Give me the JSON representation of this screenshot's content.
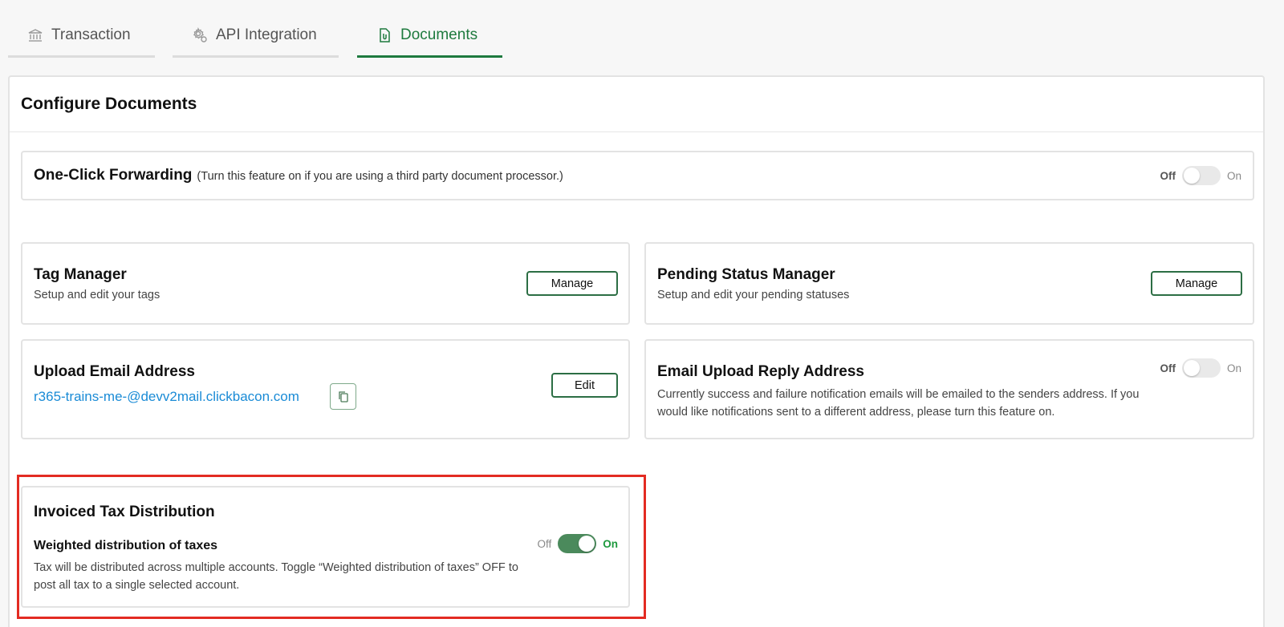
{
  "tabs": [
    {
      "label": "Transaction",
      "icon": "bank-icon",
      "active": false
    },
    {
      "label": "API Integration",
      "icon": "settings-gear-icon",
      "active": false
    },
    {
      "label": "Documents",
      "icon": "document-icon",
      "active": true
    }
  ],
  "panel": {
    "title": "Configure Documents"
  },
  "one_click": {
    "title": "One-Click Forwarding",
    "note": "(Turn this feature on if you are using a third party document processor.)",
    "toggle": {
      "off_label": "Off",
      "on_label": "On",
      "state": "off"
    }
  },
  "tag_manager": {
    "title": "Tag Manager",
    "subtitle": "Setup and edit your tags",
    "button": "Manage"
  },
  "pending_status": {
    "title": "Pending Status Manager",
    "subtitle": "Setup and edit your pending statuses",
    "button": "Manage"
  },
  "upload_email": {
    "title": "Upload Email Address",
    "email": "r365-trains-me-@devv2mail.clickbacon.com",
    "button": "Edit"
  },
  "email_reply": {
    "title": "Email Upload Reply Address",
    "description": "Currently success and failure notification emails will be emailed to the senders address. If you would like notifications sent to a different address, please turn this feature on.",
    "toggle": {
      "off_label": "Off",
      "on_label": "On",
      "state": "off"
    }
  },
  "tax_distribution": {
    "title": "Invoiced Tax Distribution",
    "option_title": "Weighted distribution of taxes",
    "description": "Tax will be distributed across multiple accounts. Toggle “Weighted distribution of taxes” OFF to post all tax to a single selected account.",
    "toggle": {
      "off_label": "Off",
      "on_label": "On",
      "state": "on"
    }
  },
  "colors": {
    "accent": "#1e7a3e",
    "link": "#1a8bd6",
    "highlight": "#e32b22"
  }
}
